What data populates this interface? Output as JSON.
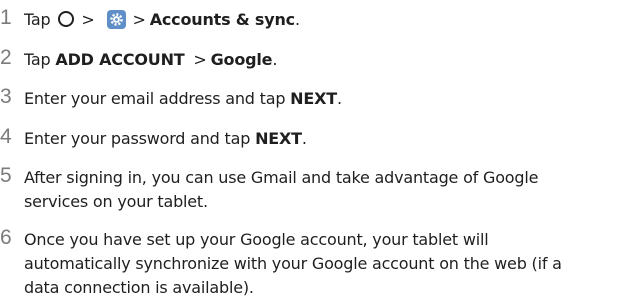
{
  "steps": [
    {
      "num": "1",
      "tap": "Tap",
      "sep1": ">",
      "sep2": ">",
      "bold": "Accounts & sync",
      "end": "."
    },
    {
      "num": "2",
      "tap": "Tap",
      "bold1": "ADD ACCOUNT",
      "sep": ">",
      "bold2": "Google",
      "end": "."
    },
    {
      "num": "3",
      "pre": "Enter your email address and tap",
      "bold": "NEXT",
      "end": "."
    },
    {
      "num": "4",
      "pre": "Enter your password and tap",
      "bold": "NEXT",
      "end": "."
    },
    {
      "num": "5",
      "line1": "After signing in, you can use Gmail and take advantage of Google",
      "line2": "services on your tablet."
    },
    {
      "num": "6",
      "line1": "Once you have set up your Google account, your tablet will",
      "line2": "automatically synchronize with your Google account on the web (if a",
      "line3": "data connection is available)."
    }
  ],
  "icons": {
    "home": "home-circle-icon",
    "settings": "settings-gear-icon",
    "settings_bg": "#5f8fc6"
  }
}
